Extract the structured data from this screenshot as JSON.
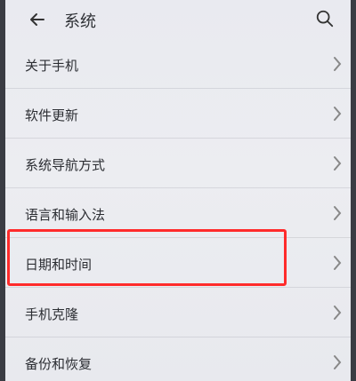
{
  "header": {
    "title": "系统"
  },
  "settings": {
    "items": [
      {
        "label": "关于手机"
      },
      {
        "label": "软件更新"
      },
      {
        "label": "系统导航方式"
      },
      {
        "label": "语言和输入法"
      },
      {
        "label": "日期和时间"
      },
      {
        "label": "手机克隆"
      },
      {
        "label": "备份和恢复"
      }
    ]
  },
  "theme": {
    "highlight_color": "#ff2b2b",
    "text_color": "#2c2e33",
    "background": "#eaebef"
  },
  "icons": {
    "back": "back-arrow-icon",
    "search": "search-icon",
    "chevron": "chevron-right-icon"
  }
}
